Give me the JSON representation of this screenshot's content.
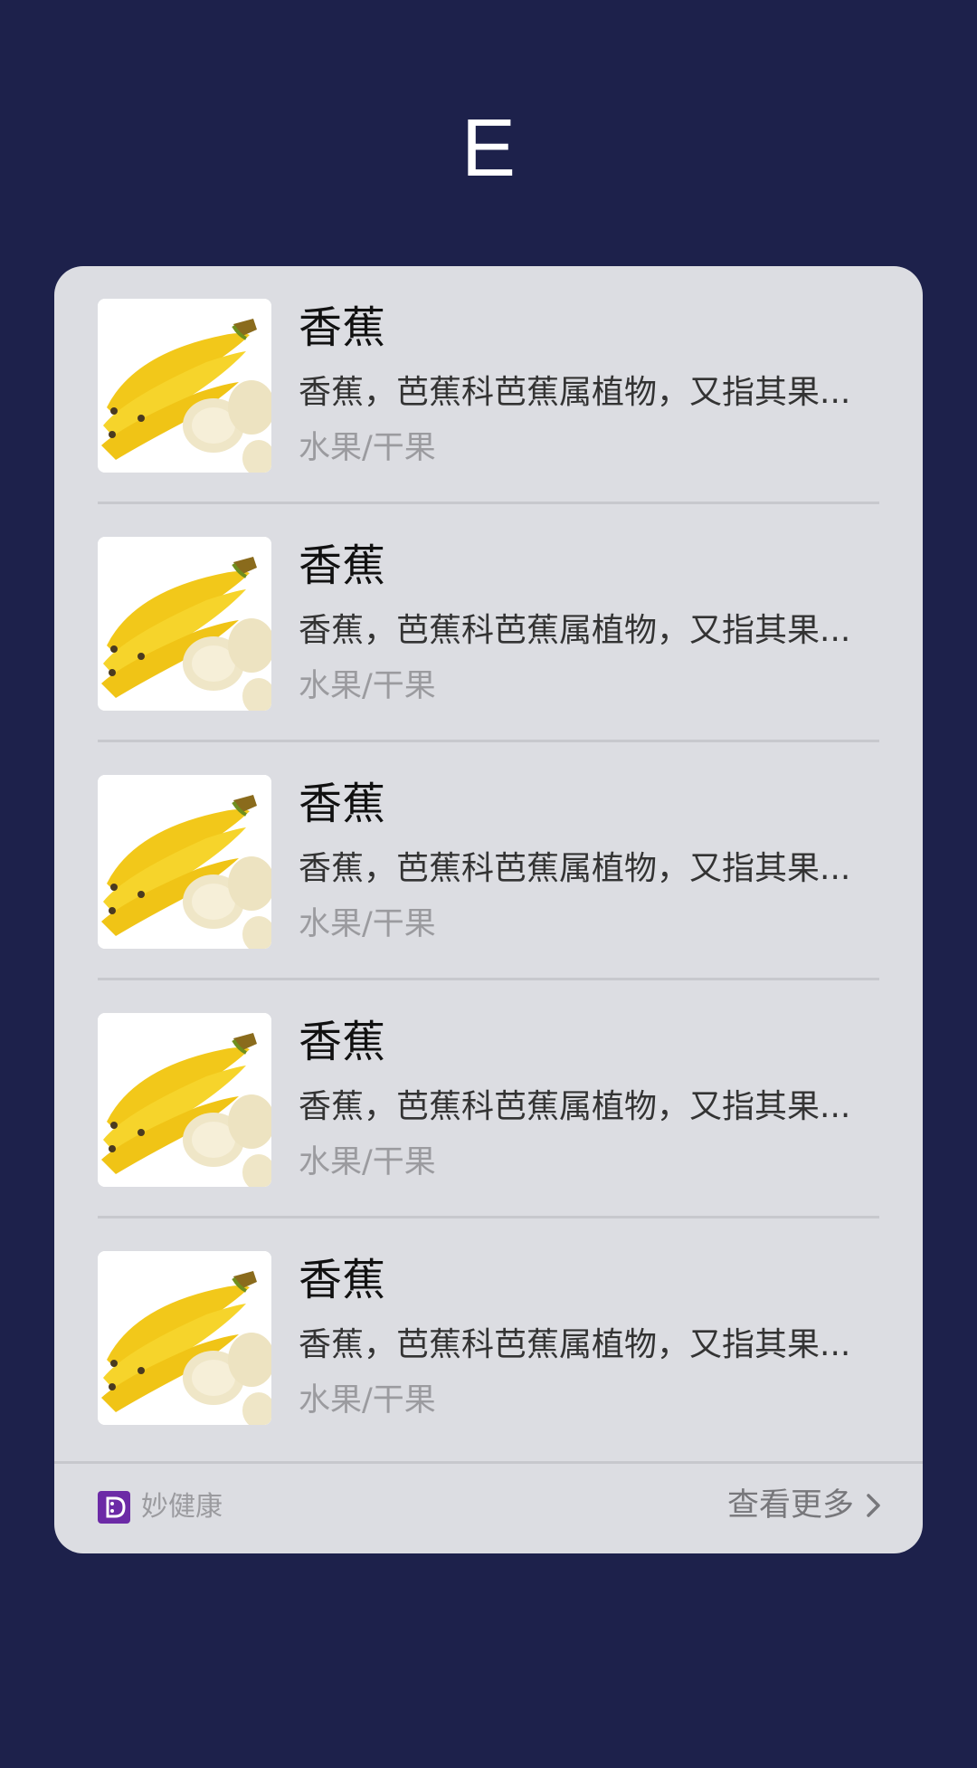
{
  "header": {
    "letter": "E"
  },
  "list": {
    "items": [
      {
        "title": "香蕉",
        "description": "香蕉，芭蕉科芭蕉属植物，又指其果...",
        "category": "水果/干果",
        "image_icon": "banana-image"
      },
      {
        "title": "香蕉",
        "description": "香蕉，芭蕉科芭蕉属植物，又指其果...",
        "category": "水果/干果",
        "image_icon": "banana-image"
      },
      {
        "title": "香蕉",
        "description": "香蕉，芭蕉科芭蕉属植物，又指其果...",
        "category": "水果/干果",
        "image_icon": "banana-image"
      },
      {
        "title": "香蕉",
        "description": "香蕉，芭蕉科芭蕉属植物，又指其果...",
        "category": "水果/干果",
        "image_icon": "banana-image"
      },
      {
        "title": "香蕉",
        "description": "香蕉，芭蕉科芭蕉属植物，又指其果...",
        "category": "水果/干果",
        "image_icon": "banana-image"
      }
    ]
  },
  "footer": {
    "brand_name": "妙健康",
    "brand_icon": "miao-health-logo-icon",
    "brand_color": "#6c2aa6",
    "more_label": "查看更多",
    "more_icon": "chevron-right-icon"
  },
  "colors": {
    "background": "#1d214b",
    "card": "#dcdde2"
  }
}
